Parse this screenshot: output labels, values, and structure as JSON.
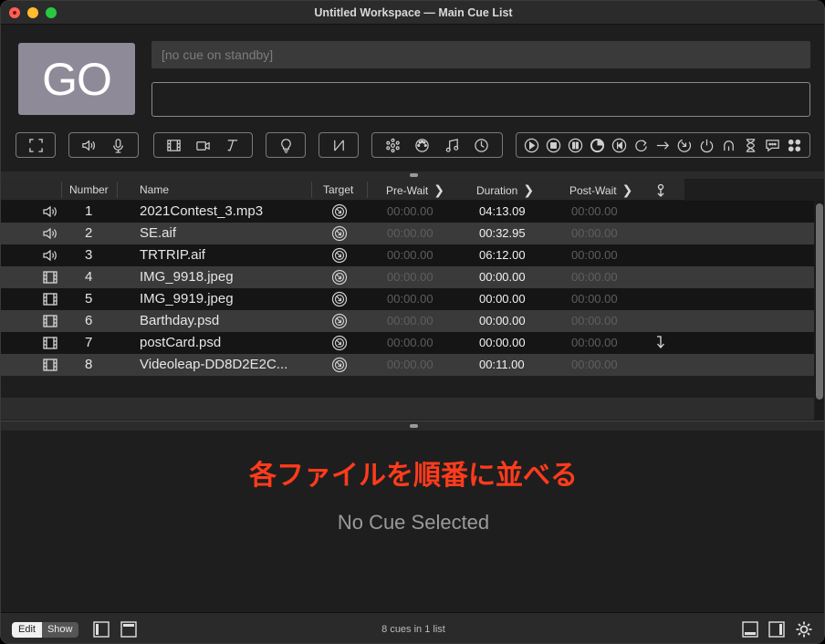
{
  "window": {
    "title": "Untitled Workspace — Main Cue List"
  },
  "go_button": {
    "label": "GO"
  },
  "standby": {
    "text": "[no cue on standby]"
  },
  "toolbar": {
    "groups": [
      [
        "fullscreen-icon"
      ],
      [
        "audio-icon",
        "mic-icon"
      ],
      [
        "video-icon",
        "camera-icon",
        "text-icon"
      ],
      [
        "light-icon"
      ],
      [
        "fade-icon"
      ],
      [
        "network-icon",
        "midi-icon",
        "music-icon",
        "timecode-icon"
      ],
      [
        "start-icon",
        "stop-icon",
        "pause-icon",
        "load-icon",
        "reset-icon",
        "goto-icon",
        "target-icon",
        "arm-icon",
        "disarm-icon",
        "devamp-icon",
        "wait-icon",
        "memo-icon",
        "script-icon"
      ]
    ]
  },
  "columns": {
    "number": "Number",
    "name": "Name",
    "target": "Target",
    "prewait": "Pre-Wait",
    "duration": "Duration",
    "postwait": "Post-Wait"
  },
  "cues": [
    {
      "type": "audio",
      "number": "1",
      "name": "2021Contest_3.mp3",
      "prewait": "00:00.00",
      "duration": "04:13.09",
      "postwait": "00:00.00",
      "continue": false
    },
    {
      "type": "audio",
      "number": "2",
      "name": "SE.aif",
      "prewait": "00:00.00",
      "duration": "00:32.95",
      "postwait": "00:00.00",
      "continue": false
    },
    {
      "type": "audio",
      "number": "3",
      "name": "TRTRIP.aif",
      "prewait": "00:00.00",
      "duration": "06:12.00",
      "postwait": "00:00.00",
      "continue": false
    },
    {
      "type": "video",
      "number": "4",
      "name": "IMG_9918.jpeg",
      "prewait": "00:00.00",
      "duration": "00:00.00",
      "postwait": "00:00.00",
      "continue": false
    },
    {
      "type": "video",
      "number": "5",
      "name": "IMG_9919.jpeg",
      "prewait": "00:00.00",
      "duration": "00:00.00",
      "postwait": "00:00.00",
      "continue": false
    },
    {
      "type": "video",
      "number": "6",
      "name": "Barthday.psd",
      "prewait": "00:00.00",
      "duration": "00:00.00",
      "postwait": "00:00.00",
      "continue": false
    },
    {
      "type": "video",
      "number": "7",
      "name": "postCard.psd",
      "prewait": "00:00.00",
      "duration": "00:00.00",
      "postwait": "00:00.00",
      "continue": true
    },
    {
      "type": "video",
      "number": "8",
      "name": "Videoleap-DD8D2E2C...",
      "prewait": "00:00.00",
      "duration": "00:11.00",
      "postwait": "00:00.00",
      "continue": false
    }
  ],
  "inspector": {
    "annotation": "各ファイルを順番に並べる",
    "empty_text": "No Cue Selected"
  },
  "statusbar": {
    "edit_label": "Edit",
    "show_label": "Show",
    "cue_count": "8 cues in 1 list"
  },
  "colors": {
    "go_button": "#8e8a98",
    "annotation": "#ff3b1c",
    "row_alt": "#3a3a3a"
  }
}
